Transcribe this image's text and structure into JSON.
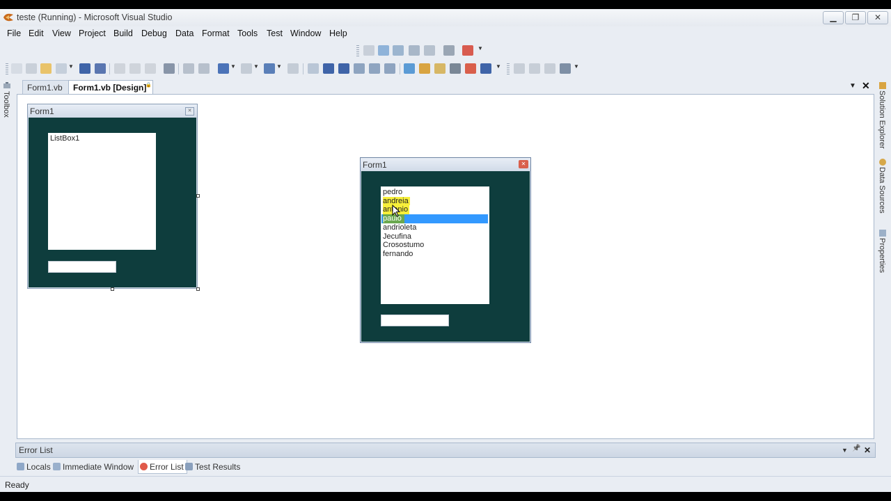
{
  "window": {
    "title": "teste (Running) - Microsoft Visual Studio",
    "minimize_glyph": "▁",
    "restore_glyph": "❐",
    "close_glyph": "✕"
  },
  "menu": [
    "File",
    "Edit",
    "View",
    "Project",
    "Build",
    "Debug",
    "Data",
    "Format",
    "Tools",
    "Test",
    "Window",
    "Help"
  ],
  "side_panels": {
    "left": "Toolbox",
    "right": [
      "Solution Explorer",
      "Data Sources",
      "Properties"
    ]
  },
  "doc_tabs": {
    "tab1": "Form1.vb",
    "tab2": "Form1.vb [Design]",
    "tab2_lock": "🔒",
    "dropdown_glyph": "▼",
    "close_glyph": "✕"
  },
  "design_form": {
    "title": "Form1",
    "close_glyph": "✕",
    "listbox_label": "ListBox1"
  },
  "running_form": {
    "title": "Form1",
    "close_glyph": "✕",
    "items": [
      "pedro",
      "andreia",
      "antonio",
      "paulo",
      "andrioleta",
      "Jecufina",
      "Crosostumo",
      "fernando"
    ],
    "highlighted": [
      "andreia",
      "antonio"
    ],
    "selected": "paulo"
  },
  "error_panel": {
    "title": "Error List",
    "dropdown_glyph": "▼",
    "pin_glyph": "📌",
    "close_glyph": "✕"
  },
  "bottom_tabs": [
    "Locals",
    "Immediate Window",
    "Error List",
    "Test Results"
  ],
  "status": "Ready",
  "colors": {
    "form_background": "#0e3d3d",
    "selection": "#3399ff",
    "highlight": "#f7ef3a"
  }
}
